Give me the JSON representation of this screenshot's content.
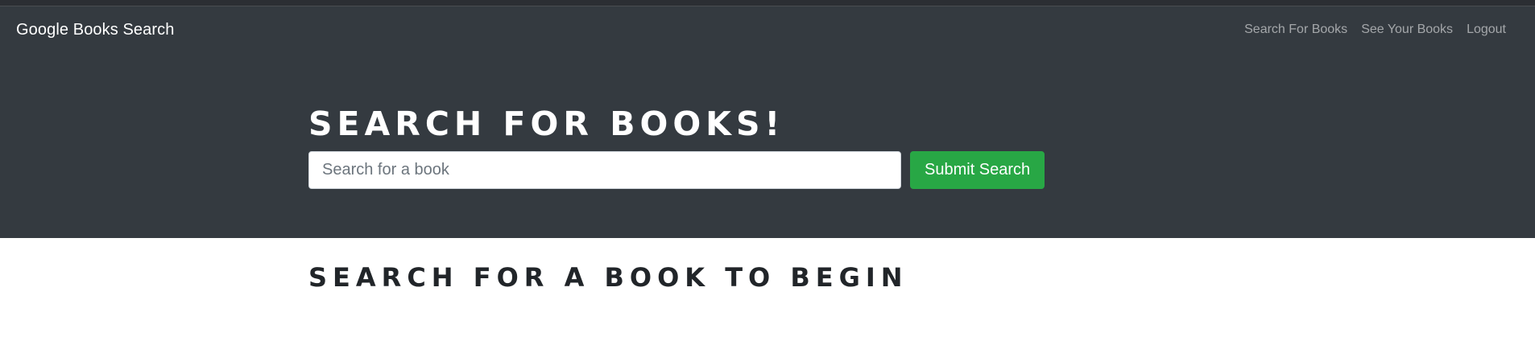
{
  "navbar": {
    "brand": "Google Books Search",
    "links": [
      {
        "label": "Search For Books"
      },
      {
        "label": "See Your Books"
      },
      {
        "label": "Logout"
      }
    ]
  },
  "hero": {
    "title": "Search for Books!",
    "search_placeholder": "Search for a book",
    "search_value": "",
    "submit_label": "Submit Search"
  },
  "content": {
    "heading": "Search for a book to begin"
  },
  "colors": {
    "navbar_bg": "#343a40",
    "submit_button": "#28a745",
    "page_bg": "#ffffff"
  }
}
